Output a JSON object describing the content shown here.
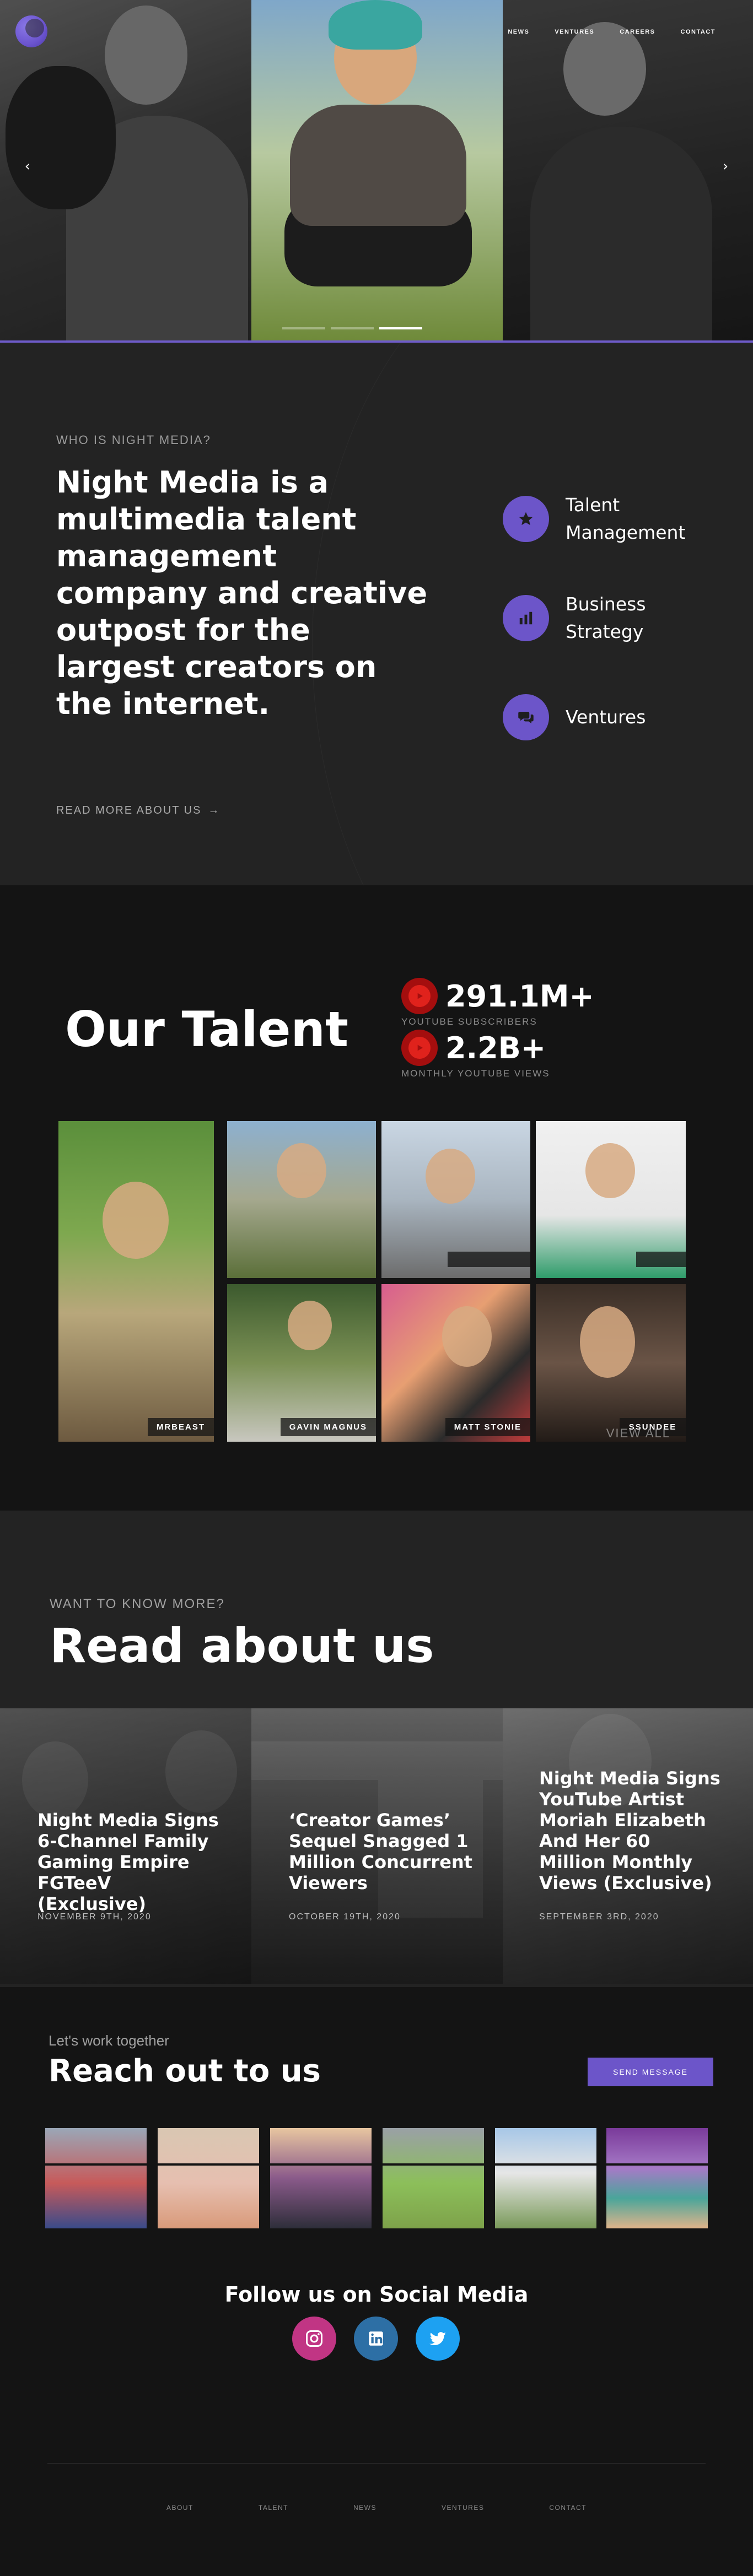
{
  "nav": {
    "items": [
      {
        "label": "NEWS"
      },
      {
        "label": "VENTURES"
      },
      {
        "label": "CAREERS"
      },
      {
        "label": "CONTACT"
      }
    ]
  },
  "hero": {
    "prev_icon": "chevron-left-icon",
    "next_icon": "chevron-right-icon",
    "slides_total": 3,
    "active_slide": 3
  },
  "about": {
    "eyebrow": "WHO IS NIGHT MEDIA?",
    "title": "Night Media is a multimedia talent management company and creative outpost for the largest creators on the internet.",
    "read_more": "READ MORE ABOUT US",
    "services": [
      {
        "label": "Talent Management",
        "icon": "star-icon"
      },
      {
        "label": "Business Strategy",
        "icon": "bar-chart-icon"
      },
      {
        "label": "Ventures",
        "icon": "chat-icon"
      }
    ]
  },
  "talent": {
    "title": "Our Talent",
    "stats": [
      {
        "value": "291.1M+",
        "label": "YOUTUBE SUBSCRIBERS",
        "icon": "youtube-icon"
      },
      {
        "value": "2.2B+",
        "label": "MONTHLY YOUTUBE VIEWS",
        "icon": "youtube-icon"
      }
    ],
    "cards": [
      {
        "name": "MRBEAST"
      },
      {
        "name": ""
      },
      {
        "name": ""
      },
      {
        "name": ""
      },
      {
        "name": "GAVIN MAGNUS"
      },
      {
        "name": "MATT STONIE"
      },
      {
        "name": "SSUNDEE"
      }
    ],
    "view_all": "VIEW ALL"
  },
  "read": {
    "eyebrow": "WANT TO KNOW MORE?",
    "title": "Read about us",
    "articles": [
      {
        "title": "Night Media Signs 6-Channel Family Gaming Empire FGTeeV (Exclusive)",
        "date": "NOVEMBER 9TH, 2020"
      },
      {
        "title": "‘Creator Games’ Sequel Snagged 1 Million Concurrent Viewers",
        "date": "OCTOBER 19TH, 2020"
      },
      {
        "title": "Night Media Signs YouTube Artist Moriah Elizabeth And Her 60 Million Monthly Views (Exclusive)",
        "date": "SEPTEMBER 3RD, 2020"
      }
    ]
  },
  "contact": {
    "eyebrow": "Let's work together",
    "title": "Reach out to us",
    "button": "SEND MESSAGE",
    "social_title": "Follow us on Social Media",
    "socials": [
      {
        "name": "instagram-icon",
        "color": "#c13584"
      },
      {
        "name": "linkedin-icon",
        "color": "#2d6fa5"
      },
      {
        "name": "twitter-icon",
        "color": "#1da1f2"
      }
    ]
  },
  "footer": {
    "items": [
      {
        "label": "ABOUT"
      },
      {
        "label": "TALENT"
      },
      {
        "label": "NEWS"
      },
      {
        "label": "VENTURES"
      },
      {
        "label": "CONTACT"
      }
    ]
  },
  "colors": {
    "accent": "#6c55c9",
    "youtube": "#e0221c",
    "dark_bg": "#141414",
    "section_bg": "#232323"
  }
}
